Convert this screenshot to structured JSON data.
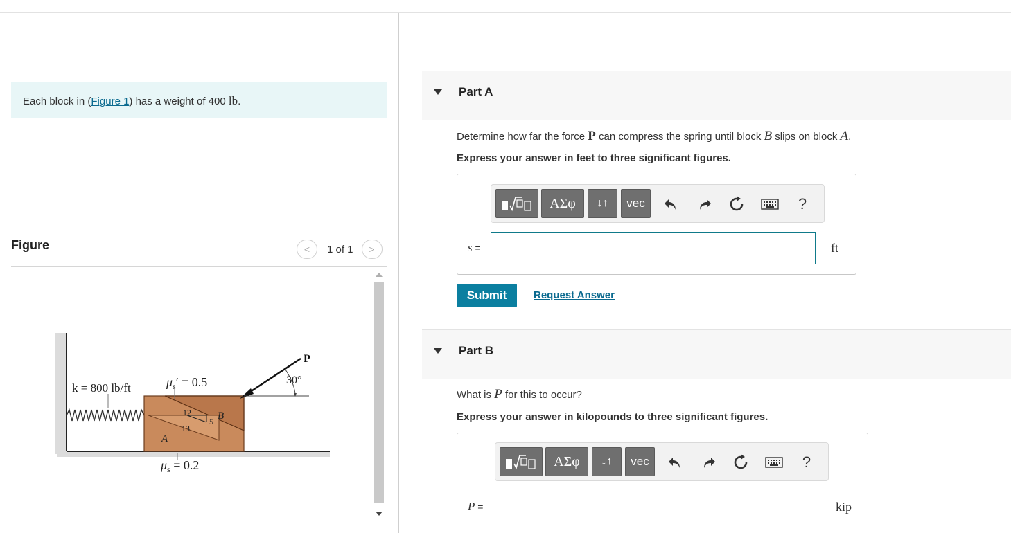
{
  "intro": {
    "prefix": "Each block in (",
    "link": "Figure 1",
    "middle": ") has a weight of 400 ",
    "unit": "lb",
    "suffix": "."
  },
  "figure": {
    "title": "Figure",
    "pager_text": "1 of 1",
    "prev_glyph": "<",
    "next_glyph": ">",
    "labels": {
      "spring": "k = 800 lb/ft",
      "mu_top": "μ′s = 0.5",
      "mu_top_main": "μ",
      "mu_top_rest": "′ = 0.5",
      "mu_top_sub": "s",
      "mu_bottom_main": "μ",
      "mu_bottom_sub": "s",
      "mu_bottom_rest": " = 0.2",
      "force": "P",
      "angle": "30°",
      "block_a": "A",
      "block_b": "B",
      "slope_12": "12",
      "slope_5": "5",
      "slope_13": "13"
    }
  },
  "partA": {
    "label": "Part A",
    "question_pre": "Determine how far the force ",
    "question_P": "P",
    "question_mid": " can compress the spring until block ",
    "question_B": "B",
    "question_mid2": " slips on block ",
    "question_A": "A",
    "question_end": ".",
    "instruction": "Express your answer in feet to three significant figures.",
    "var": "s",
    "eq": " =",
    "unit": "ft"
  },
  "partB": {
    "label": "Part B",
    "question_pre": "What is ",
    "question_P": "P",
    "question_end": " for this to occur?",
    "instruction": "Express your answer in kilopounds to three significant figures.",
    "var": "P",
    "eq": " =",
    "unit": "kip"
  },
  "toolbar": {
    "greek": "ΑΣφ",
    "arrows": "↓↑",
    "vec": "vec",
    "help": "?"
  },
  "actions": {
    "submit": "Submit",
    "request": "Request Answer"
  }
}
